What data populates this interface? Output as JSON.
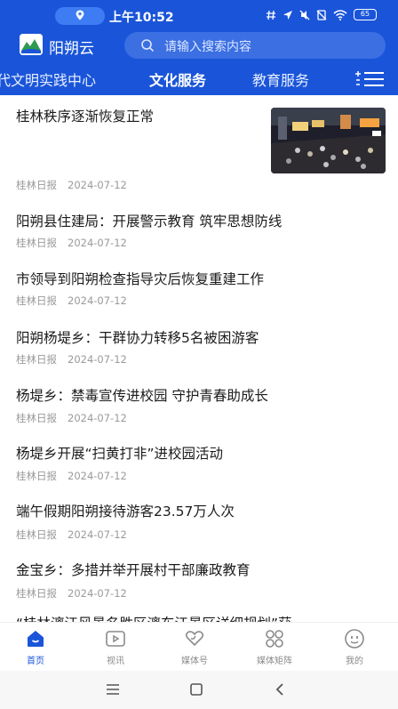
{
  "status_bar": {
    "time": "上午10:52",
    "battery": "65"
  },
  "topbar": {
    "app_name": "阳朔云",
    "search_placeholder": "请输入搜索内容"
  },
  "tabs": [
    {
      "label": "代文明实践中心",
      "active": false
    },
    {
      "label": "文化服务",
      "active": true
    },
    {
      "label": "教育服务",
      "active": false
    }
  ],
  "news": [
    {
      "title": "桂林秩序逐渐恢复正常",
      "source": "桂林日报",
      "date": "2024-07-12",
      "has_thumb": true
    },
    {
      "title": "阳朔县住建局：开展警示教育 筑牢思想防线",
      "source": "桂林日报",
      "date": "2024-07-12"
    },
    {
      "title": "市领导到阳朔检查指导灾后恢复重建工作",
      "source": "桂林日报",
      "date": "2024-07-12"
    },
    {
      "title": "阳朔杨堤乡：干群协力转移5名被困游客",
      "source": "桂林日报",
      "date": "2024-07-12"
    },
    {
      "title": "杨堤乡：禁毒宣传进校园 守护青春助成长",
      "source": "桂林日报",
      "date": "2024-07-12"
    },
    {
      "title": "杨堤乡开展“扫黄打非”进校园活动",
      "source": "桂林日报",
      "date": "2024-07-12"
    },
    {
      "title": "端午假期阳朔接待游客23.57万人次",
      "source": "桂林日报",
      "date": "2024-07-12"
    },
    {
      "title": "金宝乡：多措并举开展村干部廉政教育",
      "source": "桂林日报",
      "date": "2024-07-12"
    },
    {
      "title": "“桂林漓江风景名胜区漓东江景区详细规划”获",
      "source": "",
      "date": ""
    }
  ],
  "bottom_tabs": [
    {
      "label": "首页",
      "icon": "home-icon",
      "active": true
    },
    {
      "label": "视讯",
      "icon": "video-icon",
      "active": false
    },
    {
      "label": "媒体号",
      "icon": "heart-hand-icon",
      "active": false
    },
    {
      "label": "媒体矩阵",
      "icon": "grid-icon",
      "active": false
    },
    {
      "label": "我的",
      "icon": "profile-icon",
      "active": false
    }
  ],
  "colors": {
    "brand_blue": "#1a55d9",
    "active_tab": "#1a55d9",
    "meta_gray": "#9a9a9a"
  }
}
